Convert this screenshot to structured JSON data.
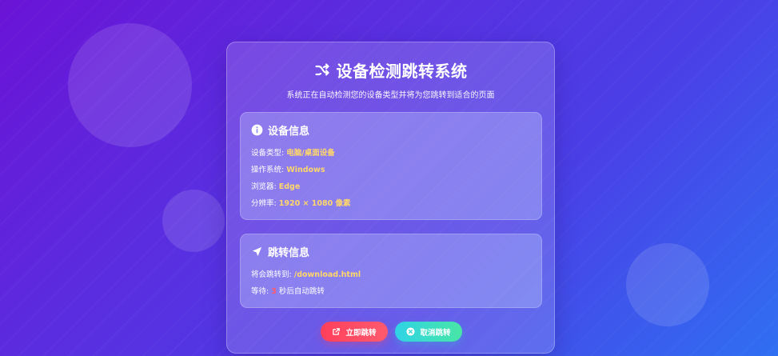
{
  "header": {
    "title": "设备检测跳转系统",
    "subtitle": "系统正在自动检测您的设备类型并将为您跳转到适合的页面",
    "icon": "shuffle-icon"
  },
  "device_info": {
    "heading": "设备信息",
    "icon": "info-circle-icon",
    "type_label": "设备类型:",
    "type_value": "电脑/桌面设备",
    "os_label": "操作系统:",
    "os_value": "Windows",
    "browser_label": "浏览器:",
    "browser_value": "Edge",
    "resolution_label": "分辨率:",
    "resolution_value": "1920 × 1080 像素"
  },
  "redirect_info": {
    "heading": "跳转信息",
    "icon": "location-arrow-icon",
    "target_label": "将会跳转到:",
    "target_value": "/download.html",
    "wait_label": "等待:",
    "countdown_value": "3",
    "wait_suffix": "秒后自动跳转"
  },
  "buttons": {
    "go_now": "立即跳转",
    "cancel": "取消跳转"
  },
  "colors": {
    "accent_value": "#ffd76a",
    "countdown": "#ff5a6a",
    "go_button": "#ff4560",
    "cancel_button": "#35d6d0"
  }
}
